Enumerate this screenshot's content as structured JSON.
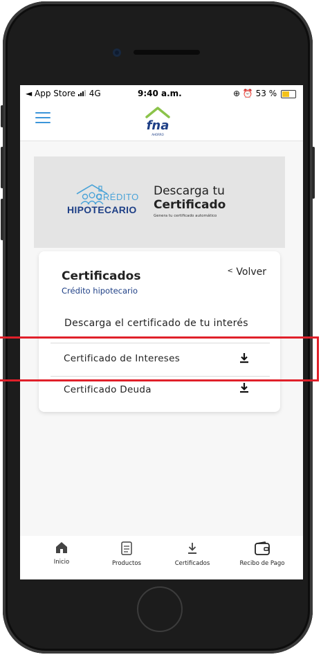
{
  "status_bar": {
    "carrier": "◄ App Store",
    "network": "4G",
    "time": "9:40 a.m.",
    "battery_text": "53 %",
    "battery_level": 0.53,
    "colors": {
      "battery": "#f4c21a"
    }
  },
  "app_bar": {
    "menu_icon": "hamburger-menu-icon",
    "logo_text": "fna",
    "logo_subtext": "AHORRO",
    "brand_color": "#1e3f86",
    "accent_color": "#3b95d9"
  },
  "banner": {
    "logo_top": "CRÉDITO",
    "logo_bottom": "HIPOTECARIO",
    "title_line1": "Descarga tu",
    "title_line2": "Certificado",
    "subtitle": "Genera tu certificado automático"
  },
  "card": {
    "title": "Certificados",
    "subtitle": "Crédito hipotecario",
    "back_label": "Volver",
    "back_icon": "chevron-left-icon",
    "section_heading": "Descarga el certificado de tu interés",
    "certificates": [
      {
        "label": "Certificado de Intereses",
        "icon": "download-icon",
        "highlighted": true
      },
      {
        "label": "Certificado Deuda",
        "icon": "download-icon",
        "highlighted": false
      }
    ]
  },
  "tab_bar": {
    "tabs": [
      {
        "label": "Inicio",
        "icon": "home-icon"
      },
      {
        "label": "Productos",
        "icon": "document-icon"
      },
      {
        "label": "Certificados",
        "icon": "download-icon"
      },
      {
        "label": "Recibo de Pago",
        "icon": "wallet-icon"
      }
    ]
  },
  "annotation": {
    "highlight_color": "#e0202a"
  }
}
